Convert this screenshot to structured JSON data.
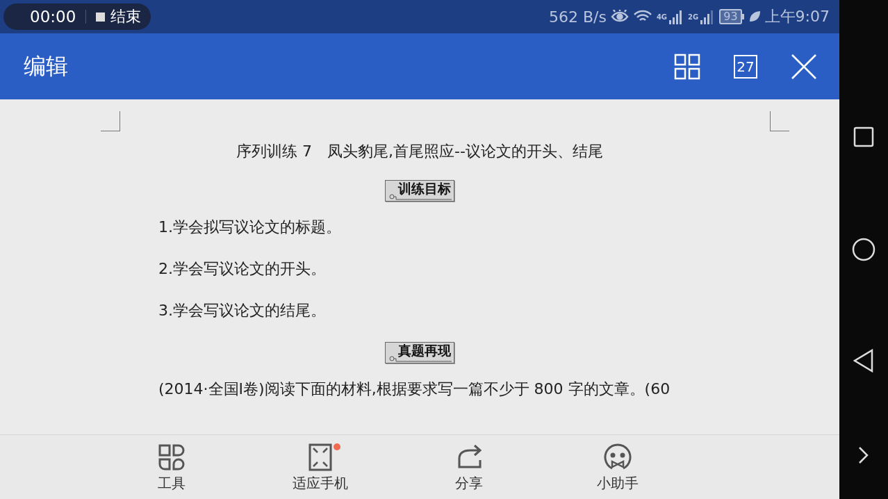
{
  "status_bar": {
    "recording_time": "00:00",
    "stop_label": "结束",
    "net_speed": "562 B/s",
    "network_4g": "4G",
    "network_2g": "2G",
    "battery": "93",
    "time": "上午9:07"
  },
  "app_bar": {
    "title": "编辑",
    "page_badge": "27"
  },
  "document": {
    "title": "序列训练 7　凤头豹尾,首尾照应--议论文的开头、结尾",
    "sections": [
      {
        "heading": "训练目标",
        "paragraphs": [
          "1.学会拟写议论文的标题。",
          "2.学会写议论文的开头。",
          "3.学会写议论文的结尾。"
        ]
      },
      {
        "heading": "真题再现",
        "paragraphs": [
          "(2014·全国Ⅰ卷)阅读下面的材料,根据要求写一篇不少于 800 字的文章。(60"
        ]
      }
    ]
  },
  "toolbar": [
    {
      "kind": "tools",
      "label": "工具",
      "badge": false
    },
    {
      "kind": "fit",
      "label": "适应手机",
      "badge": true
    },
    {
      "kind": "share",
      "label": "分享",
      "badge": false
    },
    {
      "kind": "assistant",
      "label": "小助手",
      "badge": false
    }
  ]
}
